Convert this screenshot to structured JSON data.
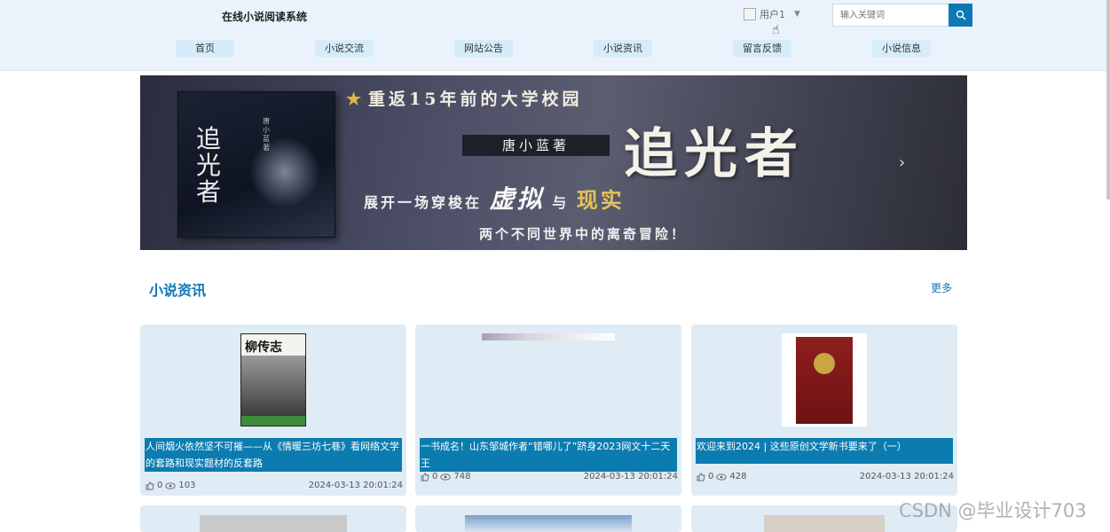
{
  "header": {
    "site_title": "在线小说阅读系统",
    "user_label": "用户1",
    "search_placeholder": "输入关键词"
  },
  "nav": [
    {
      "label": "首页"
    },
    {
      "label": "小说交流"
    },
    {
      "label": "网站公告"
    },
    {
      "label": "小说资讯"
    },
    {
      "label": "留言反馈"
    },
    {
      "label": "小说信息"
    }
  ],
  "banner": {
    "tagline": "重返15年前的大学校园",
    "author": "唐小蓝著",
    "title": "追光者",
    "book_title": "追光者",
    "book_author": "唐小蓝著",
    "line1_a": "展开一场穿梭在",
    "line1_virtual": "虚拟",
    "line1_b": "与",
    "line1_real": "现实",
    "line2": "两个不同世界中的离奇冒险！"
  },
  "section": {
    "title": "小说资讯",
    "more": "更多"
  },
  "cards": [
    {
      "cover_text": "柳传志",
      "title": "人间烟火依然坚不可摧——从《情暖三坊七巷》看网络文学的套路和现实题材的反套路",
      "likes": "0",
      "views": "103",
      "date": "2024-03-13 20:01:24"
    },
    {
      "title": "一书成名！山东邹城作者“错哪儿了”跻身2023网文十二天王",
      "likes": "0",
      "views": "748",
      "date": "2024-03-13 20:01:24"
    },
    {
      "title": "欢迎来到2024 | 这些原创文学新书要来了（一）",
      "likes": "0",
      "views": "428",
      "date": "2024-03-13 20:01:24"
    }
  ],
  "watermark": "CSDN @毕业设计703",
  "colors": {
    "accent": "#0c78b5",
    "header_bg": "#eaf3fb",
    "nav_item_bg": "#d6ecfa",
    "card_bg": "#dfebf5",
    "caption_bg": "#0c7cb0"
  },
  "icons": {
    "search": "search-icon",
    "like": "thumbs-up-icon",
    "views": "eye-icon",
    "caret": "chevron-down-icon",
    "banner_next": "chevron-right-icon"
  }
}
